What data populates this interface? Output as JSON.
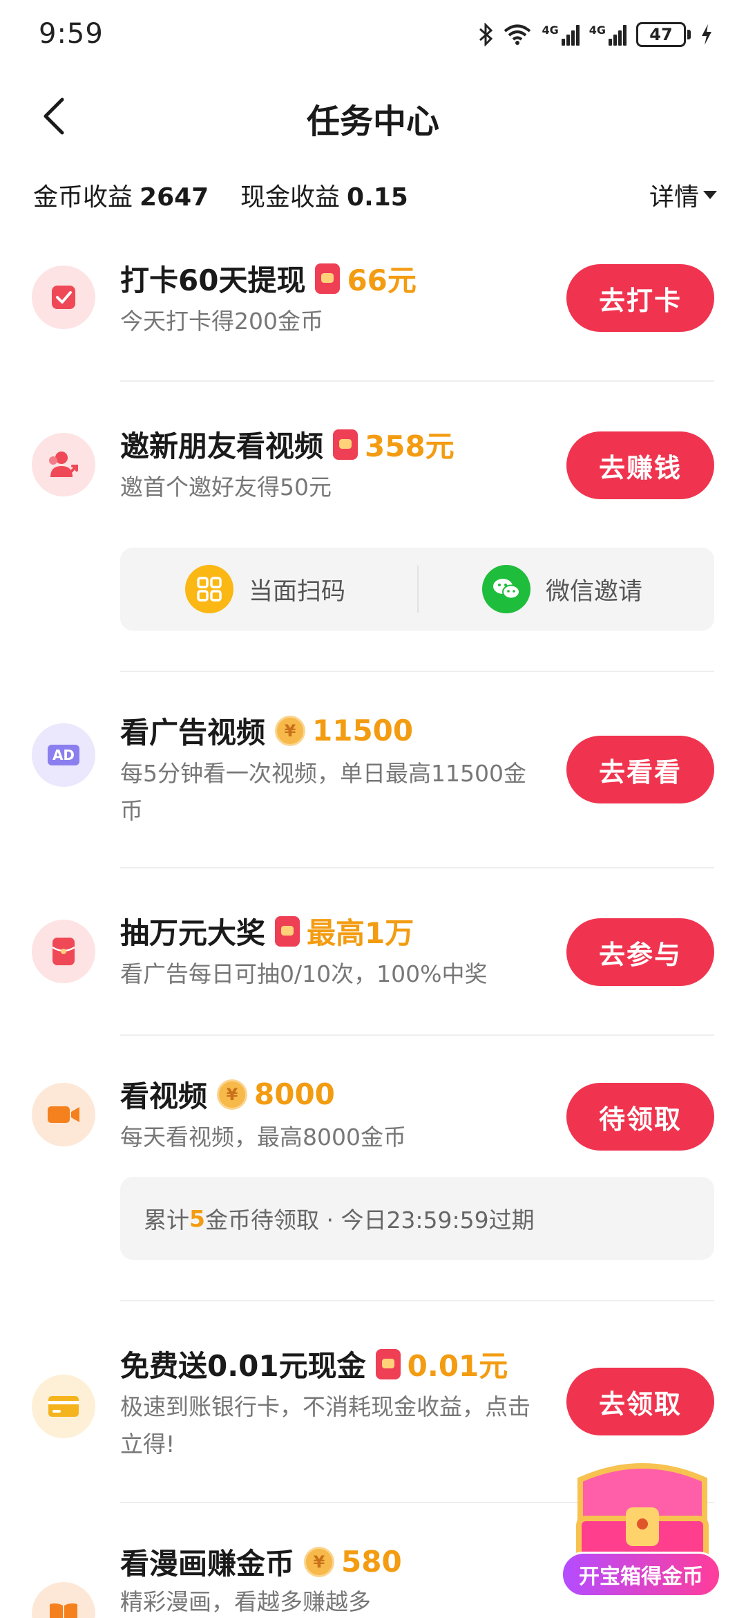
{
  "status_bar": {
    "time": "9:59",
    "network1": "4G",
    "network2": "4G",
    "battery": "47"
  },
  "header": {
    "title": "任务中心"
  },
  "earnings": {
    "coin_label": "金币收益",
    "coin_value": "2647",
    "cash_label": "现金收益",
    "cash_value": "0.15",
    "details_label": "详情"
  },
  "tasks": [
    {
      "title": "打卡60天提现",
      "reward": "66元",
      "reward_icon": "red-packet-icon",
      "desc": "今天打卡得200金币",
      "button": "去打卡",
      "icon": "checkbox-icon"
    },
    {
      "title": "邀新朋友看视频",
      "reward": "358元",
      "reward_icon": "red-packet-icon",
      "desc": "邀首个邀好友得50元",
      "button": "去赚钱",
      "icon": "invite-friends-icon",
      "options": [
        {
          "label": "当面扫码",
          "icon": "qr-code-icon"
        },
        {
          "label": "微信邀请",
          "icon": "wechat-icon"
        }
      ]
    },
    {
      "title": "看广告视频",
      "reward": "11500",
      "reward_icon": "coin-icon",
      "desc": "每5分钟看一次视频，单日最高11500金币",
      "button": "去看看",
      "icon": "ad-icon",
      "icon_text": "AD"
    },
    {
      "title": "抽万元大奖",
      "reward": "最高1万",
      "reward_icon": "red-packet-icon",
      "desc": "看广告每日可抽0/10次，100%中奖",
      "button": "去参与",
      "icon": "lottery-icon"
    },
    {
      "title": "看视频",
      "reward": "8000",
      "reward_icon": "coin-icon",
      "desc": "每天看视频，最高8000金币",
      "button": "待领取",
      "icon": "video-camera-icon",
      "pending": {
        "prefix": "累计",
        "count": "5",
        "suffix": "金币待领取 · 今日23:59:59过期"
      }
    },
    {
      "title": "免费送0.01元现金",
      "reward": "0.01元",
      "reward_icon": "red-packet-icon",
      "desc": "极速到账银行卡，不消耗现金收益，点击立得!",
      "button": "去领取",
      "icon": "bank-card-icon"
    },
    {
      "title": "看漫画赚金币",
      "reward": "580",
      "reward_icon": "coin-icon",
      "desc": "精彩漫画，看越多赚越多",
      "icon": "book-icon"
    }
  ],
  "coin_symbol": "¥",
  "treasure": {
    "label": "开宝箱得金币"
  },
  "colors": {
    "accent": "#f0344f",
    "reward": "#f39c12"
  }
}
